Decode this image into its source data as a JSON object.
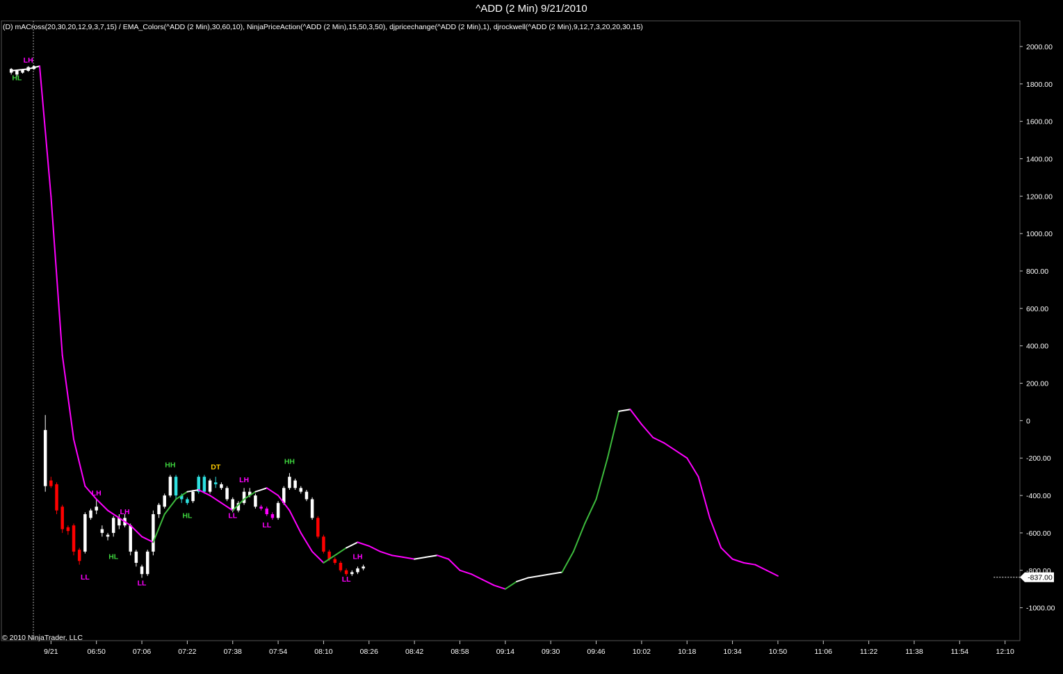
{
  "header": {
    "title": "^ADD (2 Min)  9/21/2010",
    "indicators": "(D) mACross(20,30,20,12,9,3,7,15) / EMA_Colors(^ADD (2 Min),30,60,10), NinjaPriceAction(^ADD (2 Min),15,50,3,50), djpricechange(^ADD (2 Min),1), djrockwell(^ADD (2 Min),9,12,7,3,20,20,30,15)",
    "copyright": "© 2010 NinjaTrader, LLC"
  },
  "chart_data": {
    "type": "candlestick",
    "title": "^ADD (2 Min)  9/21/2010",
    "ylim": [
      -1150,
      2100
    ],
    "y_ticks": [
      2000,
      1800,
      1600,
      1400,
      1200,
      1000,
      800,
      600,
      400,
      200,
      0,
      -200,
      -400,
      -600,
      -800,
      -1000
    ],
    "y_tick_labels": [
      "2000.00",
      "1800.00",
      "1600.00",
      "1400.00",
      "1200.00",
      "1000.00",
      "800.00",
      "600.00",
      "400.00",
      "200.00",
      "0",
      "-200.00",
      "-400.00",
      "-600.00",
      "-800.00",
      "-1000.00"
    ],
    "last_price_label": "-837.00",
    "last_price": -837,
    "x_range": [
      -4,
      174
    ],
    "x_ticks": [
      {
        "bar": 4,
        "label": "9/21"
      },
      {
        "bar": 12,
        "label": "06:50"
      },
      {
        "bar": 20,
        "label": "07:06"
      },
      {
        "bar": 28,
        "label": "07:22"
      },
      {
        "bar": 36,
        "label": "07:38"
      },
      {
        "bar": 44,
        "label": "07:54"
      },
      {
        "bar": 52,
        "label": "08:10"
      },
      {
        "bar": 60,
        "label": "08:26"
      },
      {
        "bar": 68,
        "label": "08:42"
      },
      {
        "bar": 76,
        "label": "08:58"
      },
      {
        "bar": 84,
        "label": "09:14"
      },
      {
        "bar": 92,
        "label": "09:30"
      },
      {
        "bar": 100,
        "label": "09:46"
      },
      {
        "bar": 108,
        "label": "10:02"
      },
      {
        "bar": 116,
        "label": "10:18"
      },
      {
        "bar": 124,
        "label": "10:34"
      },
      {
        "bar": 132,
        "label": "10:50"
      },
      {
        "bar": 140,
        "label": "11:06"
      },
      {
        "bar": 148,
        "label": "11:22"
      },
      {
        "bar": 156,
        "label": "11:38"
      },
      {
        "bar": 164,
        "label": "11:54"
      },
      {
        "bar": 172,
        "label": "12:10"
      }
    ],
    "ema": [
      [
        -3,
        1870
      ],
      [
        0,
        1880
      ],
      [
        2,
        1895
      ],
      [
        4,
        1200
      ],
      [
        6,
        350
      ],
      [
        8,
        -100
      ],
      [
        10,
        -350
      ],
      [
        12,
        -420
      ],
      [
        14,
        -480
      ],
      [
        16,
        -520
      ],
      [
        18,
        -560
      ],
      [
        20,
        -620
      ],
      [
        22,
        -650
      ],
      [
        24,
        -500
      ],
      [
        26,
        -420
      ],
      [
        28,
        -380
      ],
      [
        30,
        -370
      ],
      [
        32,
        -400
      ],
      [
        34,
        -440
      ],
      [
        36,
        -480
      ],
      [
        38,
        -420
      ],
      [
        40,
        -380
      ],
      [
        42,
        -360
      ],
      [
        44,
        -400
      ],
      [
        46,
        -480
      ],
      [
        48,
        -600
      ],
      [
        50,
        -700
      ],
      [
        52,
        -760
      ],
      [
        54,
        -720
      ],
      [
        56,
        -680
      ],
      [
        58,
        -650
      ],
      [
        60,
        -670
      ],
      [
        62,
        -700
      ],
      [
        64,
        -720
      ],
      [
        66,
        -730
      ],
      [
        68,
        -740
      ],
      [
        70,
        -730
      ],
      [
        72,
        -720
      ],
      [
        74,
        -740
      ],
      [
        76,
        -800
      ],
      [
        78,
        -820
      ],
      [
        80,
        -850
      ],
      [
        82,
        -880
      ],
      [
        84,
        -900
      ],
      [
        86,
        -860
      ],
      [
        88,
        -840
      ],
      [
        90,
        -830
      ],
      [
        92,
        -820
      ],
      [
        94,
        -810
      ],
      [
        96,
        -700
      ],
      [
        98,
        -550
      ],
      [
        100,
        -420
      ],
      [
        102,
        -200
      ],
      [
        104,
        50
      ],
      [
        106,
        60
      ],
      [
        108,
        -20
      ],
      [
        110,
        -90
      ],
      [
        112,
        -120
      ],
      [
        114,
        -160
      ],
      [
        116,
        -200
      ],
      [
        118,
        -300
      ],
      [
        120,
        -520
      ],
      [
        122,
        -680
      ],
      [
        124,
        -740
      ],
      [
        126,
        -760
      ],
      [
        128,
        -770
      ],
      [
        130,
        -800
      ],
      [
        132,
        -830
      ]
    ],
    "ema_colors": [
      "#ff00ff",
      "#ffffff",
      "#3dbb3d"
    ],
    "candles": [
      [
        -3,
        1860,
        1880,
        1850,
        1885,
        "#ffffff"
      ],
      [
        -2,
        1850,
        1870,
        1840,
        1875,
        "#ffffff"
      ],
      [
        -1,
        1860,
        1875,
        1855,
        1880,
        "#ffffff"
      ],
      [
        0,
        1870,
        1890,
        1865,
        1895,
        "#ffffff"
      ],
      [
        1,
        1880,
        1895,
        1875,
        1900,
        "#ffffff"
      ],
      [
        3,
        -350,
        -50,
        -380,
        30,
        "#ffffff"
      ],
      [
        4,
        -320,
        -350,
        -360,
        -300,
        "#ff0000"
      ],
      [
        5,
        -340,
        -480,
        -500,
        -330,
        "#ff0000"
      ],
      [
        6,
        -460,
        -580,
        -600,
        -450,
        "#ff0000"
      ],
      [
        7,
        -570,
        -590,
        -610,
        -560,
        "#ff0000"
      ],
      [
        8,
        -560,
        -700,
        -720,
        -550,
        "#ff0000"
      ],
      [
        9,
        -690,
        -750,
        -770,
        -680,
        "#ff0000"
      ],
      [
        10,
        -700,
        -500,
        -710,
        -490,
        "#ffffff"
      ],
      [
        11,
        -520,
        -480,
        -530,
        -470,
        "#ffffff"
      ],
      [
        12,
        -480,
        -460,
        -500,
        -420,
        "#ffffff"
      ],
      [
        13,
        -600,
        -580,
        -620,
        -560,
        "#ffffff"
      ],
      [
        14,
        -610,
        -620,
        -640,
        -600,
        "#ffffff"
      ],
      [
        15,
        -600,
        -520,
        -620,
        -510,
        "#ffffff"
      ],
      [
        16,
        -520,
        -560,
        -580,
        -500,
        "#ffffff"
      ],
      [
        17,
        -560,
        -520,
        -570,
        -500,
        "#ffffff"
      ],
      [
        18,
        -560,
        -700,
        -720,
        -550,
        "#ffffff"
      ],
      [
        19,
        -700,
        -760,
        -780,
        -690,
        "#ffffff"
      ],
      [
        20,
        -780,
        -820,
        -840,
        -770,
        "#ffffff"
      ],
      [
        21,
        -820,
        -700,
        -830,
        -690,
        "#ffffff"
      ],
      [
        22,
        -700,
        -500,
        -720,
        -480,
        "#ffffff"
      ],
      [
        23,
        -500,
        -450,
        -520,
        -440,
        "#ffffff"
      ],
      [
        24,
        -460,
        -400,
        -470,
        -390,
        "#ffffff"
      ],
      [
        25,
        -400,
        -300,
        -410,
        -290,
        "#ffffff"
      ],
      [
        26,
        -300,
        -400,
        -420,
        -290,
        "#2ee0e0"
      ],
      [
        27,
        -400,
        -420,
        -440,
        -390,
        "#2ee0e0"
      ],
      [
        28,
        -420,
        -440,
        -450,
        -410,
        "#2ee0e0"
      ],
      [
        29,
        -430,
        -380,
        -440,
        -370,
        "#ffffff"
      ],
      [
        30,
        -380,
        -300,
        -390,
        -290,
        "#2ee0e0"
      ],
      [
        31,
        -300,
        -380,
        -390,
        -290,
        "#2ee0e0"
      ],
      [
        32,
        -380,
        -320,
        -390,
        -310,
        "#ffffff"
      ],
      [
        33,
        -330,
        -340,
        -360,
        -300,
        "#2ee0e0"
      ],
      [
        34,
        -340,
        -360,
        -370,
        -330,
        "#ffffff"
      ],
      [
        35,
        -360,
        -420,
        -430,
        -350,
        "#ffffff"
      ],
      [
        36,
        -420,
        -480,
        -490,
        -410,
        "#ffffff"
      ],
      [
        37,
        -480,
        -440,
        -490,
        -430,
        "#ffffff"
      ],
      [
        38,
        -440,
        -380,
        -450,
        -360,
        "#ffffff"
      ],
      [
        39,
        -380,
        -400,
        -410,
        -360,
        "#ffffff"
      ],
      [
        40,
        -400,
        -460,
        -470,
        -390,
        "#ffffff"
      ],
      [
        41,
        -460,
        -470,
        -480,
        -450,
        "#ff00ff"
      ],
      [
        42,
        -470,
        -500,
        -510,
        -460,
        "#ff00ff"
      ],
      [
        43,
        -500,
        -520,
        -530,
        -490,
        "#ff00ff"
      ],
      [
        44,
        -520,
        -440,
        -530,
        -430,
        "#ffffff"
      ],
      [
        45,
        -440,
        -360,
        -450,
        -350,
        "#ffffff"
      ],
      [
        46,
        -360,
        -300,
        -370,
        -280,
        "#ffffff"
      ],
      [
        47,
        -320,
        -360,
        -370,
        -310,
        "#ffffff"
      ],
      [
        48,
        -360,
        -380,
        -390,
        -350,
        "#ffffff"
      ],
      [
        49,
        -380,
        -420,
        -430,
        -370,
        "#ffffff"
      ],
      [
        50,
        -420,
        -520,
        -530,
        -410,
        "#ffffff"
      ],
      [
        51,
        -520,
        -620,
        -630,
        -510,
        "#ff0000"
      ],
      [
        52,
        -620,
        -700,
        -710,
        -610,
        "#ff0000"
      ],
      [
        53,
        -700,
        -740,
        -750,
        -690,
        "#ff0000"
      ],
      [
        54,
        -740,
        -760,
        -770,
        -730,
        "#ff0000"
      ],
      [
        55,
        -760,
        -800,
        -810,
        -750,
        "#ff0000"
      ],
      [
        56,
        -800,
        -820,
        -830,
        -790,
        "#ff0000"
      ],
      [
        57,
        -820,
        -810,
        -830,
        -800,
        "#ffffff"
      ],
      [
        58,
        -810,
        -790,
        -820,
        -780,
        "#ffffff"
      ],
      [
        59,
        -790,
        -780,
        -800,
        -770,
        "#ffffff"
      ]
    ],
    "labels": [
      {
        "x": 0,
        "y": 1915,
        "text": "LH",
        "color": "#ff00ff"
      },
      {
        "x": -2,
        "y": 1820,
        "text": "HL",
        "color": "#3dd13d"
      },
      {
        "x": 10,
        "y": -850,
        "text": "LL",
        "color": "#ff00ff"
      },
      {
        "x": 12,
        "y": -400,
        "text": "LH",
        "color": "#ff00ff"
      },
      {
        "x": 15,
        "y": -740,
        "text": "HL",
        "color": "#3dd13d"
      },
      {
        "x": 17,
        "y": -500,
        "text": "LH",
        "color": "#ff00ff"
      },
      {
        "x": 20,
        "y": -880,
        "text": "LL",
        "color": "#ff00ff"
      },
      {
        "x": 25,
        "y": -250,
        "text": "HH",
        "color": "#3dd13d"
      },
      {
        "x": 28,
        "y": -520,
        "text": "HL",
        "color": "#3dd13d"
      },
      {
        "x": 33,
        "y": -260,
        "text": "DT",
        "color": "#ffcc00"
      },
      {
        "x": 36,
        "y": -520,
        "text": "LL",
        "color": "#ff00ff"
      },
      {
        "x": 38,
        "y": -330,
        "text": "LH",
        "color": "#ff00ff"
      },
      {
        "x": 42,
        "y": -570,
        "text": "LL",
        "color": "#ff00ff"
      },
      {
        "x": 46,
        "y": -230,
        "text": "HH",
        "color": "#3dd13d"
      },
      {
        "x": 56,
        "y": -860,
        "text": "LL",
        "color": "#ff00ff"
      },
      {
        "x": 58,
        "y": -740,
        "text": "LH",
        "color": "#ff00ff"
      }
    ]
  }
}
